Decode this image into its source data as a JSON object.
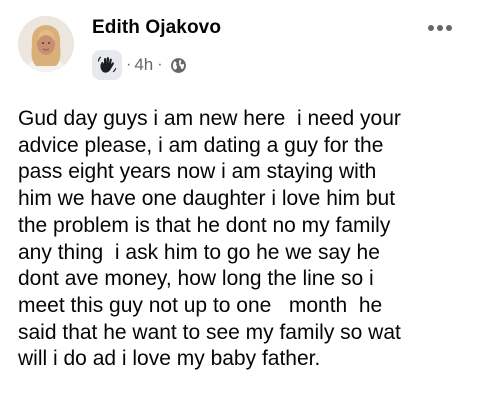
{
  "post": {
    "author": "Edith Ojakovo",
    "time": "4h",
    "separator": "·",
    "badge_icon": "waving-hand-icon",
    "audience_icon": "globe-icon",
    "menu_icon": "more-options-icon",
    "body": "Gud day guys i am new here  i need your\nadvice please, i am dating a guy for the\npass eight years now i am staying with\nhim we have one daughter i love him but\nthe problem is that he dont no my family\nany thing  i ask him to go he we say he\ndont ave money, how long the line so i\nmeet this guy not up to one   month  he\nsaid that he want to see my family so wat\nwill i do ad i love my baby father."
  },
  "colors": {
    "text": "#050505",
    "secondary_text": "#65676b",
    "badge_background": "#e7e9ee"
  }
}
